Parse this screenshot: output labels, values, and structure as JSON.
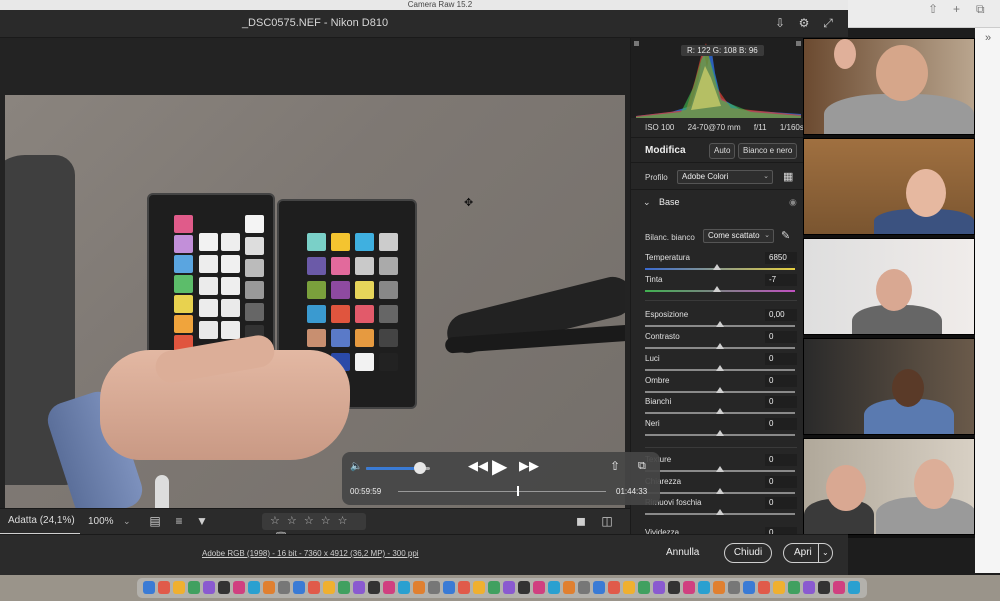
{
  "menubar": {
    "title": "Camera Raw 15.2"
  },
  "window": {
    "title": "_DSC0575.NEF  -  Nikon D810"
  },
  "titlebar_icons": [
    "save-icon",
    "gear-icon",
    "fullscreen-icon"
  ],
  "canvas_bar": {
    "zoom_fit": "Adatta (24,1%)",
    "zoom_level": "100%",
    "stars": "☆ ☆ ☆ ☆ ☆"
  },
  "histogram": {
    "readout": "R: 122   G: 108   B: 96"
  },
  "exif": {
    "iso": "ISO 100",
    "lens": "24-70@70 mm",
    "aperture": "f/11",
    "shutter": "1/160s"
  },
  "edit": {
    "title": "Modifica",
    "auto": "Auto",
    "bw": "Bianco e nero",
    "profile_label": "Profilo",
    "profile_value": "Adobe Colori",
    "section": "Base",
    "wb_label": "Bilanc. bianco",
    "wb_value": "Come scattato",
    "sliders": [
      {
        "name": "Temperatura",
        "value": "6850",
        "pos": 0.48
      },
      {
        "name": "Tinta",
        "value": "-7",
        "pos": 0.48
      },
      {
        "name": "Esposizione",
        "value": "0,00",
        "pos": 0.5
      },
      {
        "name": "Contrasto",
        "value": "0",
        "pos": 0.5
      },
      {
        "name": "Luci",
        "value": "0",
        "pos": 0.5
      },
      {
        "name": "Ombre",
        "value": "0",
        "pos": 0.5
      },
      {
        "name": "Bianchi",
        "value": "0",
        "pos": 0.5
      },
      {
        "name": "Neri",
        "value": "0",
        "pos": 0.5
      },
      {
        "name": "Texture",
        "value": "0",
        "pos": 0.5
      },
      {
        "name": "Chiarezza",
        "value": "0",
        "pos": 0.5
      },
      {
        "name": "Rimuovi foschia",
        "value": "0",
        "pos": 0.5
      },
      {
        "name": "Vividezza",
        "value": "0",
        "pos": 0.5
      }
    ]
  },
  "status": {
    "info": "Adobe RGB (1998) - 16 bit - 7360 x 4912 (36,2 MP) - 300 ppi",
    "cancel": "Annulla",
    "close": "Chiudi",
    "open": "Apri"
  },
  "player": {
    "current": "00:59:59",
    "total": "01:44:33",
    "progress": 0.57,
    "volume": 0.85
  }
}
